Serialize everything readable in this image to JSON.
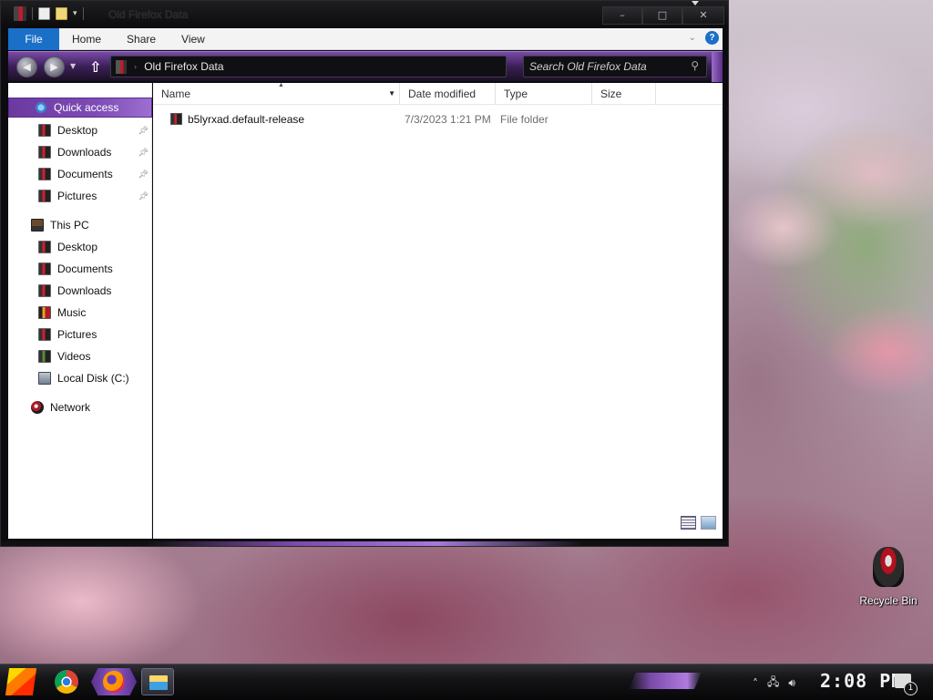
{
  "window": {
    "title": "Old Firefox Data",
    "caption": {
      "minimize": "–",
      "maximize": "□",
      "close": "✕"
    }
  },
  "ribbon": {
    "tabs": [
      "File",
      "Home",
      "Share",
      "View"
    ],
    "help": "?"
  },
  "navbar": {
    "back": "◀",
    "forward": "▶",
    "up": "⇧",
    "breadcrumb": "Old Firefox Data",
    "search_placeholder": "Search Old Firefox Data"
  },
  "sidebar": {
    "quick_access": {
      "label": "Quick access",
      "items": [
        {
          "label": "Desktop",
          "pinned": true
        },
        {
          "label": "Downloads",
          "pinned": true
        },
        {
          "label": "Documents",
          "pinned": true
        },
        {
          "label": "Pictures",
          "pinned": true
        }
      ]
    },
    "this_pc": {
      "label": "This PC",
      "items": [
        {
          "label": "Desktop"
        },
        {
          "label": "Documents"
        },
        {
          "label": "Downloads"
        },
        {
          "label": "Music"
        },
        {
          "label": "Pictures"
        },
        {
          "label": "Videos"
        },
        {
          "label": "Local Disk (C:)"
        }
      ]
    },
    "network": {
      "label": "Network"
    }
  },
  "content": {
    "columns": [
      "Name",
      "Date modified",
      "Type",
      "Size"
    ],
    "rows": [
      {
        "name": "b5lyrxad.default-release",
        "date_modified": "7/3/2023 1:21 PM",
        "type": "File folder",
        "size": ""
      }
    ]
  },
  "desktop": {
    "icons": [
      {
        "label": "Recycle Bin"
      }
    ]
  },
  "taskbar": {
    "clock": "2:08 PM",
    "notifications_count": "1"
  },
  "colors": {
    "accent_purple": "#7a4aa8",
    "ribbon_file_blue": "#1a6fc7",
    "selection_purple": "#6b3aa0"
  }
}
